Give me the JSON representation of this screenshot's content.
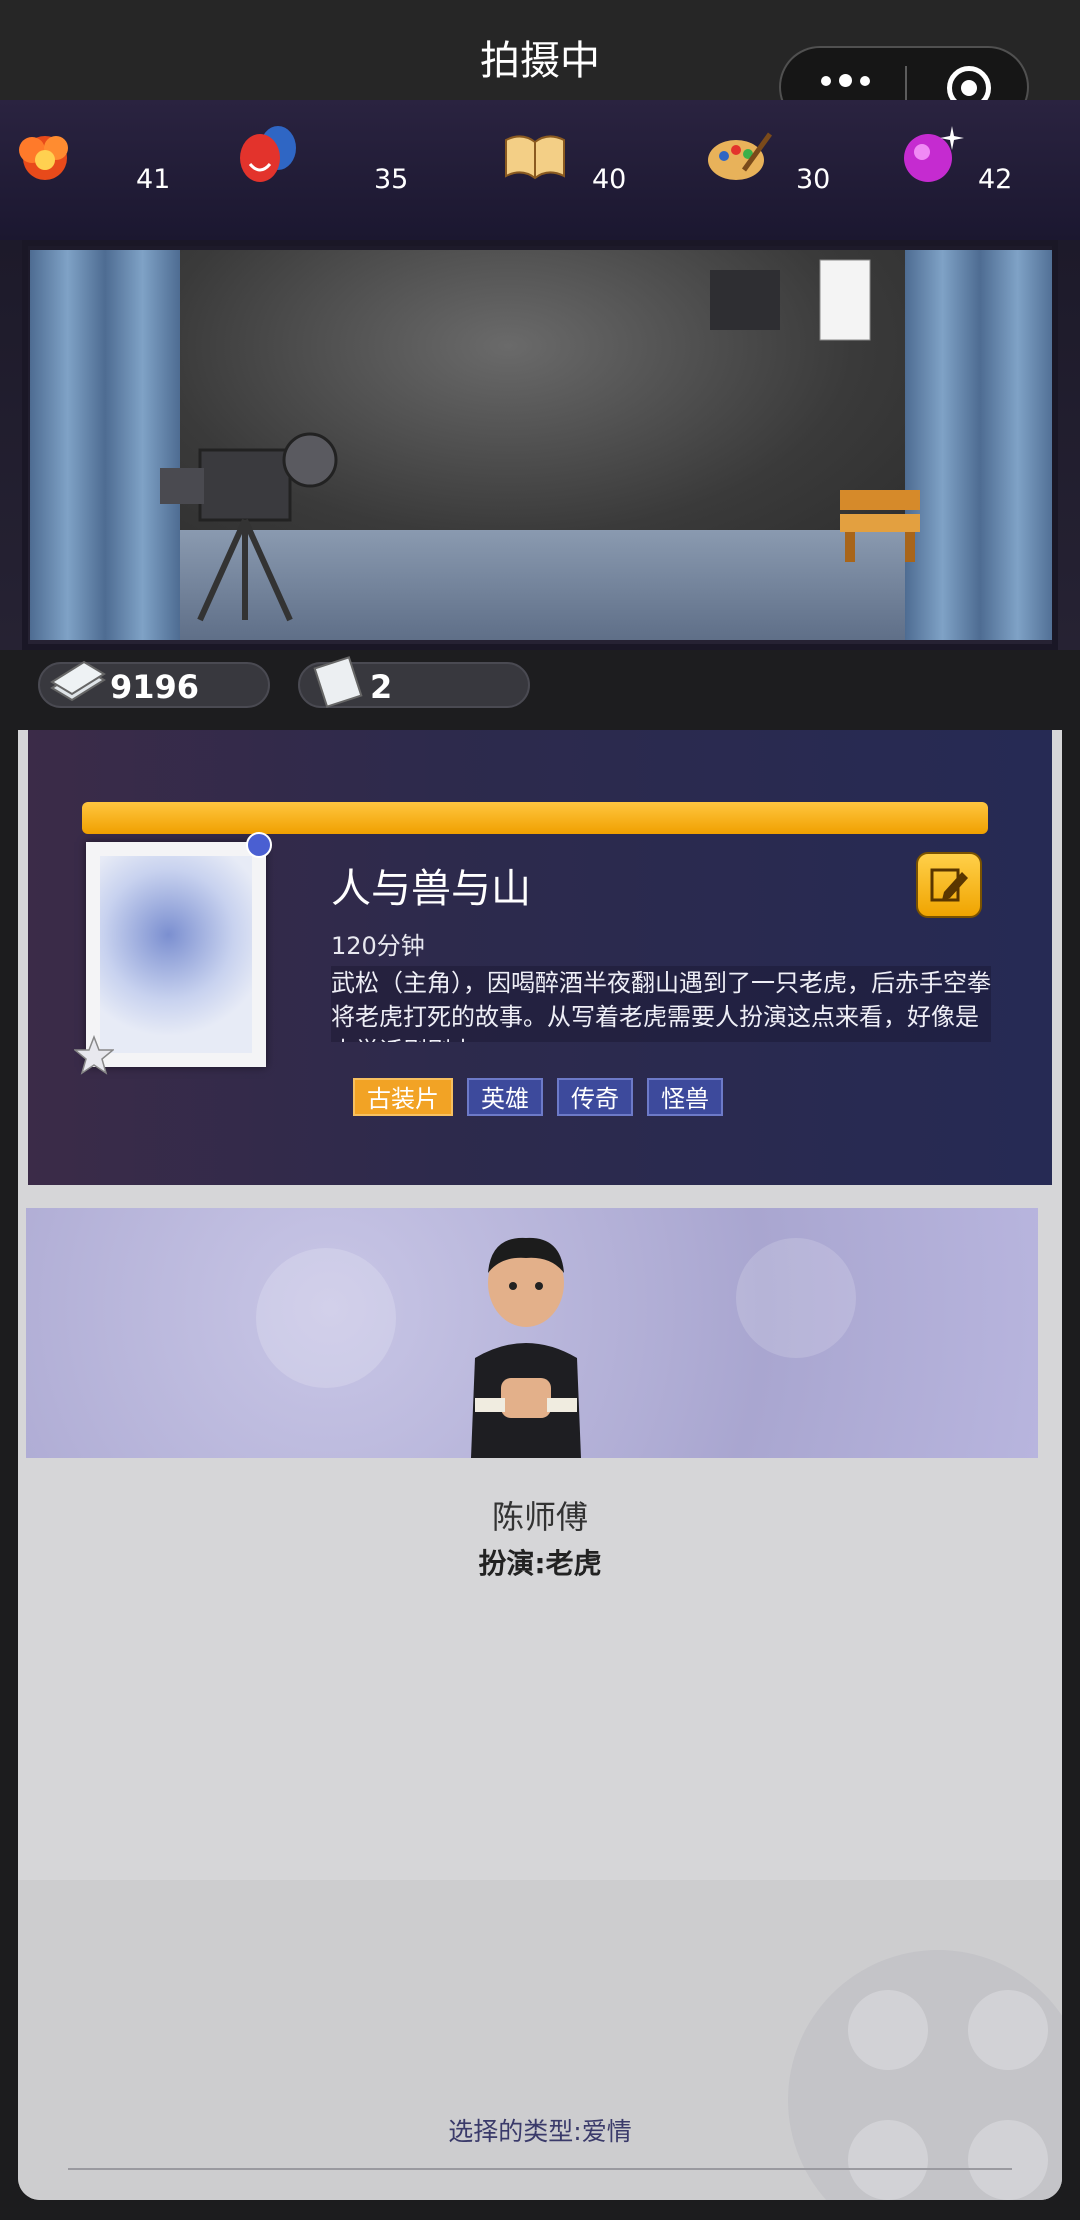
{
  "window": {
    "title": "拍摄中"
  },
  "stats": [
    {
      "icon": "explosion-icon",
      "value": "41"
    },
    {
      "icon": "drama-masks-icon",
      "value": "35"
    },
    {
      "icon": "open-book-icon",
      "value": "40"
    },
    {
      "icon": "palette-icon",
      "value": "30"
    },
    {
      "icon": "disco-ball-icon",
      "value": "42"
    }
  ],
  "currency": {
    "money": "9196",
    "scripts": "2"
  },
  "script": {
    "title": "人与兽与山",
    "duration": "120分钟",
    "description": "武松（主角），因喝醉酒半夜翻山遇到了一只老虎，后赤手空拳将老虎打死的故事。从写着老虎需要人扮演这点来看，好像是大学话剧剧本……",
    "tags": [
      "古装片",
      "英雄",
      "传奇",
      "怪兽"
    ],
    "progress": 1.0
  },
  "actor": {
    "name": "陈师傅",
    "role": "扮演:老虎"
  },
  "footer": {
    "genre": "选择的类型:爱情"
  },
  "colors": {
    "accent": "#f2a325",
    "card_bg": "#2d2a4c",
    "tag_bg": "#3d4a9c"
  }
}
